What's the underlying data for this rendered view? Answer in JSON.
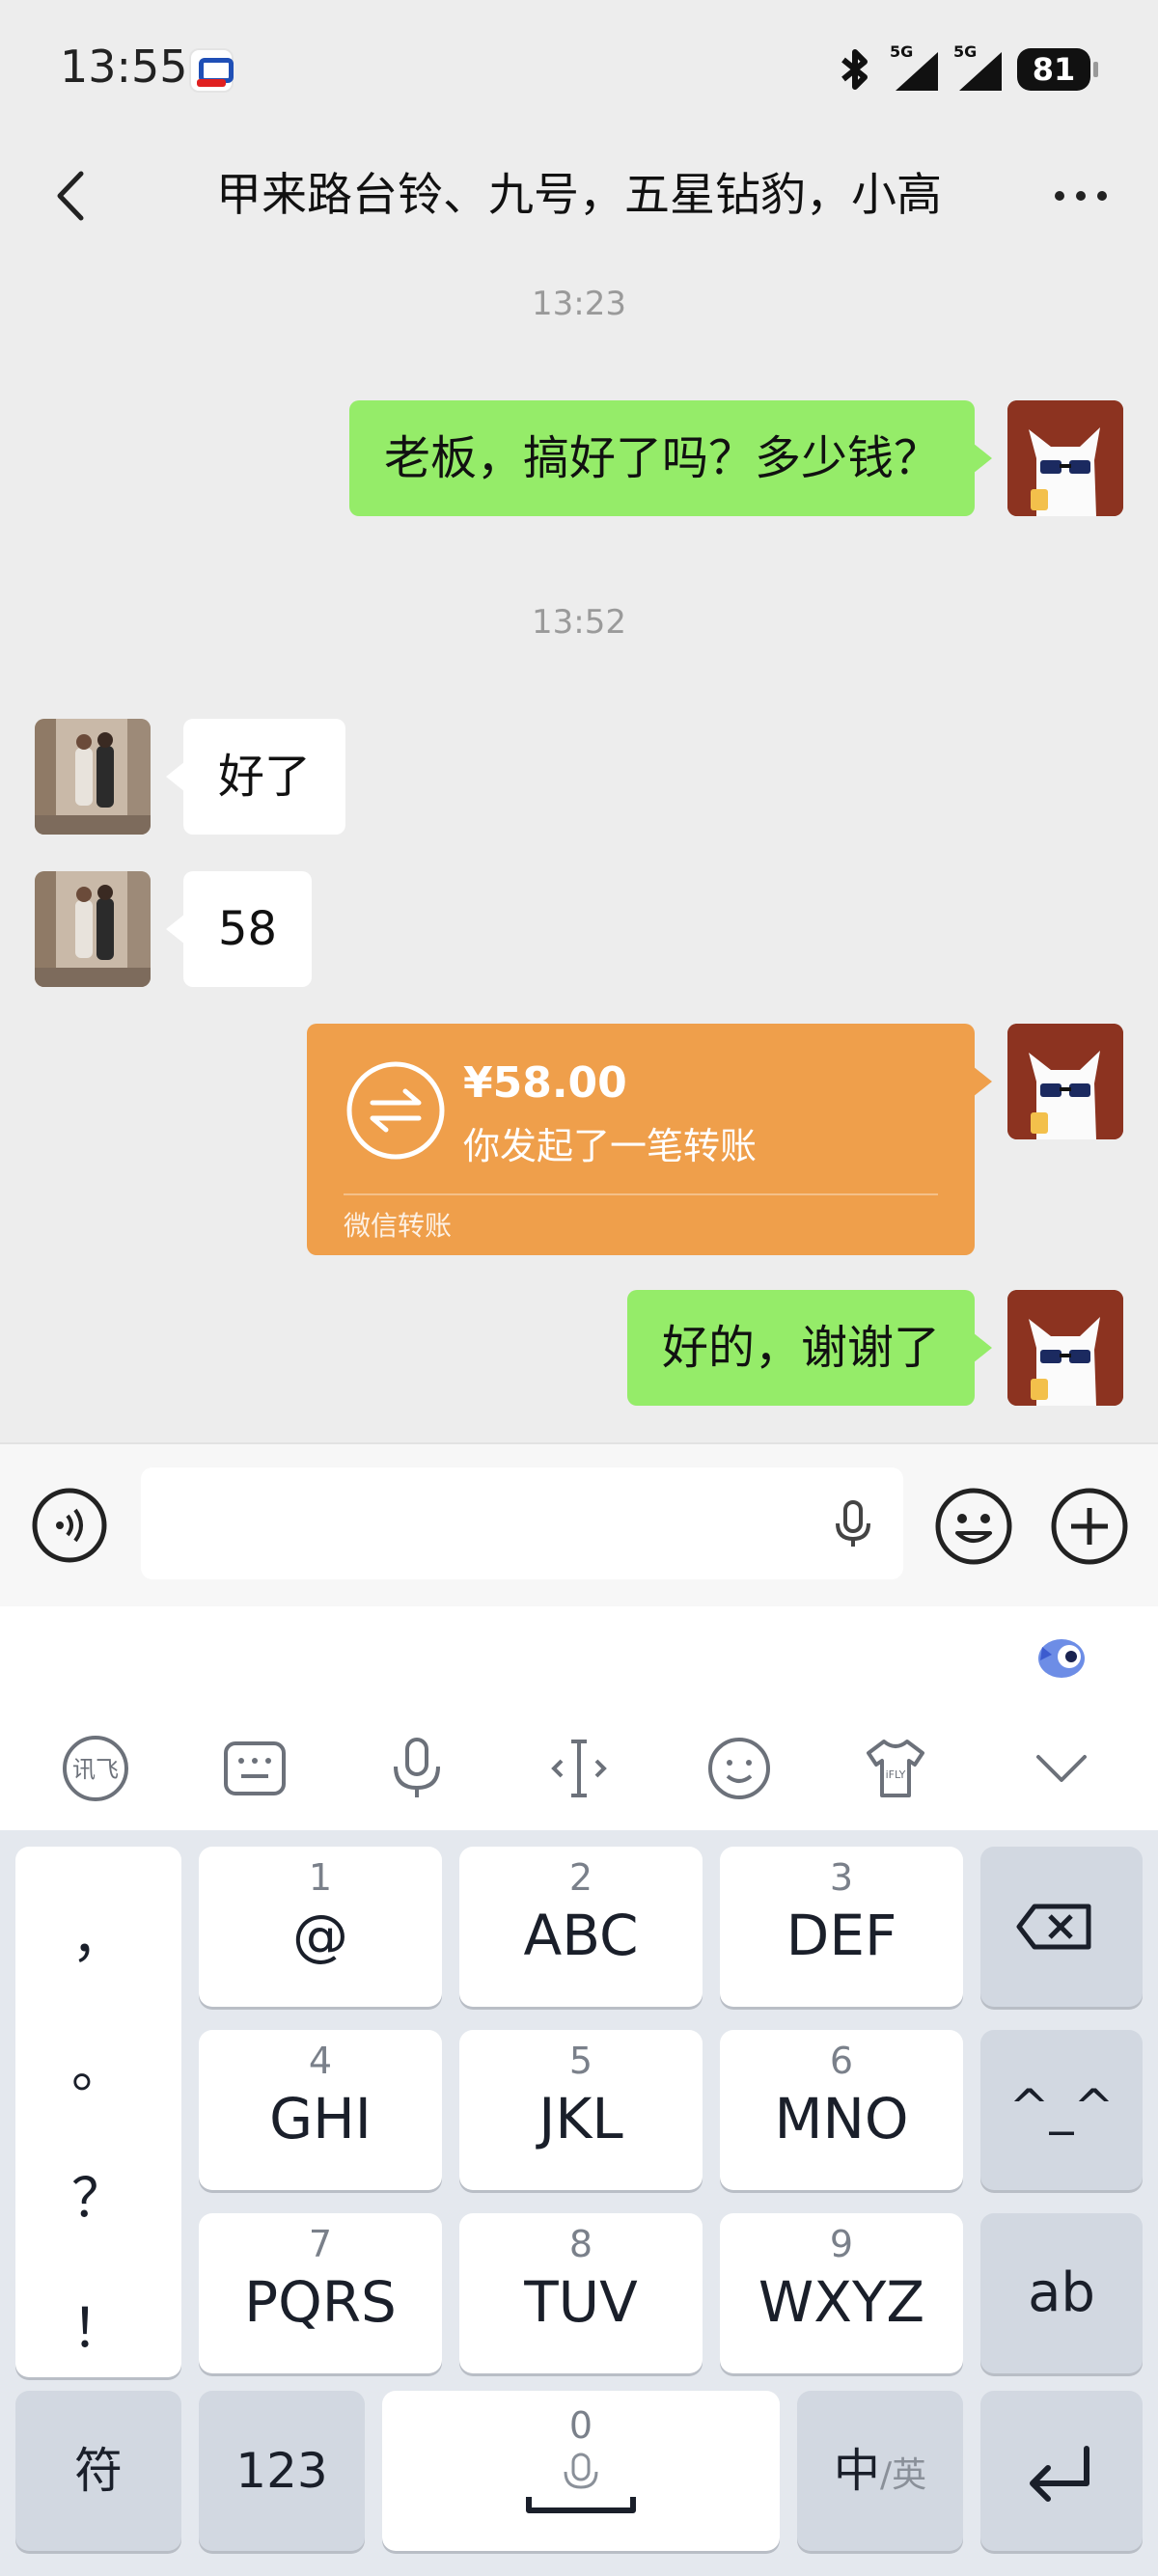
{
  "status_bar": {
    "time": "13:55",
    "signal_1": "5G",
    "signal_2": "5G",
    "battery": "81"
  },
  "header": {
    "title": "甲来路台铃、九号，五星钻豹，小高",
    "back_icon": "chevron-left-icon",
    "more_icon": "more-dots-icon"
  },
  "messages": {
    "ts1": "13:23",
    "msg1": "老板，搞好了吗？多少钱？",
    "ts2": "13:52",
    "msg2": "好了",
    "msg3": "58",
    "transfer": {
      "amount": "¥58.00",
      "desc": "你发起了一笔转账",
      "footer": "微信转账"
    },
    "msg5": "好的，谢谢了"
  },
  "input": {
    "value": "",
    "voice_icon": "voice-icon",
    "mic_icon": "microphone-icon",
    "emoji_icon": "emoji-icon",
    "plus_icon": "plus-icon"
  },
  "keyboard": {
    "tools": [
      "ifly-logo-icon",
      "keyboard-icon",
      "microphone-icon",
      "cursor-icon",
      "emoji-icon",
      "theme-shirt-icon",
      "collapse-chevron-icon"
    ],
    "punctuation": [
      "，",
      "。",
      "？",
      "！"
    ],
    "keys": [
      {
        "num": "1",
        "letters": "@"
      },
      {
        "num": "2",
        "letters": "ABC"
      },
      {
        "num": "3",
        "letters": "DEF"
      },
      {
        "num": "4",
        "letters": "GHI"
      },
      {
        "num": "5",
        "letters": "JKL"
      },
      {
        "num": "6",
        "letters": "MNO"
      },
      {
        "num": "7",
        "letters": "PQRS"
      },
      {
        "num": "8",
        "letters": "TUV"
      },
      {
        "num": "9",
        "letters": "WXYZ"
      }
    ],
    "emoticon": "^_^",
    "ab": "ab",
    "symbol": "符",
    "numeric": "123",
    "space_num": "0",
    "lang_zh": "中",
    "lang_sep": "/英"
  },
  "colors": {
    "my_bubble": "#95ec69",
    "transfer": "#ef9f4b",
    "chat_bg": "#ededed"
  }
}
